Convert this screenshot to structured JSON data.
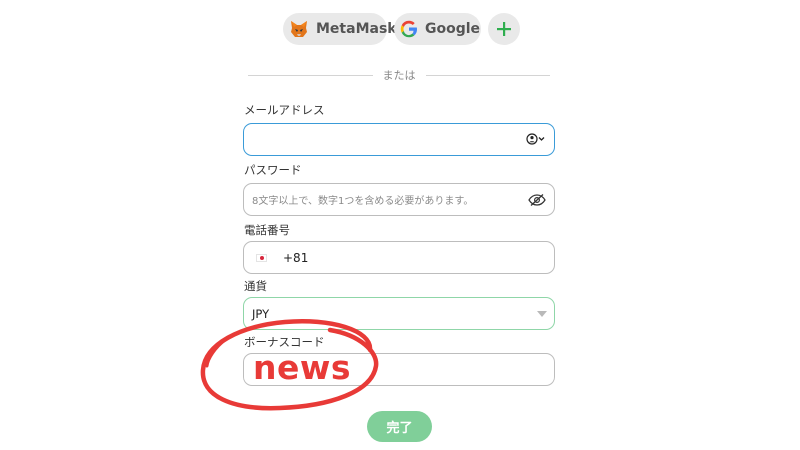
{
  "social": {
    "metamask_label": "MetaMask",
    "google_label": "Google",
    "add_icon": "plus-icon"
  },
  "divider_text": "または",
  "email": {
    "label": "メールアドレス",
    "value": "",
    "icon": "account-dropdown-icon"
  },
  "password": {
    "label": "パスワード",
    "placeholder": "8文字以上で、数字1つを含める必要があります。",
    "icon": "eye-slash-icon"
  },
  "phone": {
    "label": "電話番号",
    "country_code": "+81",
    "flag": "japan-flag-icon"
  },
  "currency": {
    "label": "通貨",
    "selected": "JPY"
  },
  "bonus_code": {
    "label": "ボーナスコード",
    "value": "news"
  },
  "submit_label": "完了",
  "colors": {
    "email_border": "#3a9bd8",
    "currency_border": "#8fd6a8",
    "submit_bg": "#80cf99",
    "annotation_red": "#e83a37",
    "plus_green": "#2fae4f"
  }
}
